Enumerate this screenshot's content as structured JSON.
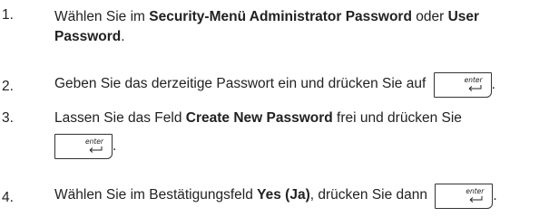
{
  "steps": [
    {
      "num": "1.",
      "p1": "Wählen Sie im ",
      "b1": "Security-Menü Administrator Password",
      "p2": " oder ",
      "b2": "User Password",
      "p3": "."
    },
    {
      "num": "2.",
      "p1": "Geben Sie das derzeitige Passwort ein und drücken Sie auf",
      "p2": "."
    },
    {
      "num": "3.",
      "p1": "Lassen Sie das Feld ",
      "b1": "Create New Password",
      "p2": " frei und drücken Sie",
      "p3": "."
    },
    {
      "num": "4.",
      "p1": "Wählen Sie im Bestätigungsfeld ",
      "b1": "Yes (Ja)",
      "p2": ", drücken Sie dann",
      "p3": "."
    }
  ],
  "enter_key": {
    "label": "enter",
    "icon": "enter-arrow-icon"
  }
}
